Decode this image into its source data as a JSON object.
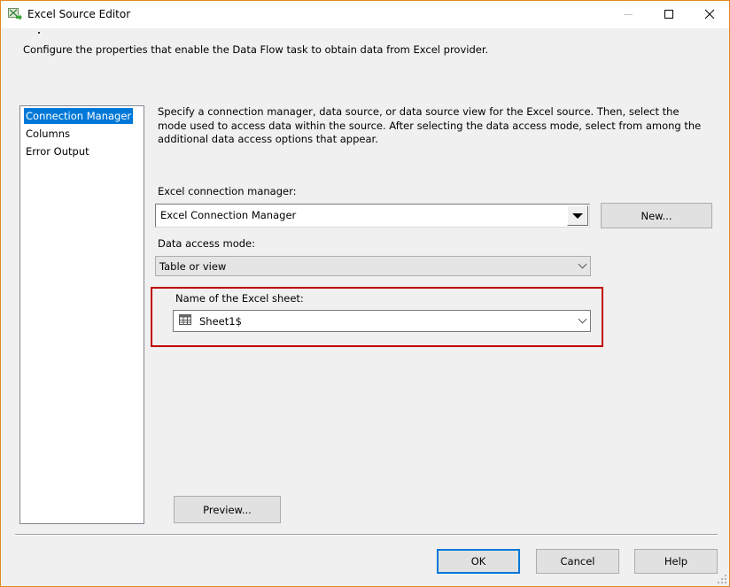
{
  "window": {
    "title": "Excel Source Editor",
    "icon": "excel-source-icon",
    "controls": {
      "minimize": "minimize-icon",
      "maximize": "maximize-icon",
      "close": "close-icon"
    },
    "close_glyph": "✕"
  },
  "header": {
    "description": "Configure the properties that enable the Data Flow task to obtain data from Excel provider."
  },
  "nav": {
    "items": [
      {
        "label": "Connection Manager",
        "selected": true
      },
      {
        "label": "Columns",
        "selected": false
      },
      {
        "label": "Error Output",
        "selected": false
      }
    ]
  },
  "main": {
    "description": "Specify a connection manager, data source, or data source view for the Excel source. Then, select the mode used to access data within the source. After selecting the data access mode, select from among the additional data access options that appear.",
    "connection_manager": {
      "label": "Excel connection manager:",
      "value": "Excel Connection Manager",
      "new_button": "New..."
    },
    "data_access_mode": {
      "label": "Data access mode:",
      "value": "Table or view"
    },
    "sheet": {
      "label": "Name of the Excel sheet:",
      "value": "Sheet1$",
      "icon": "table-icon",
      "highlight_color": "#c00000"
    },
    "preview_button": "Preview..."
  },
  "footer": {
    "ok": "OK",
    "cancel": "Cancel",
    "help": "Help"
  },
  "colors": {
    "accent": "#0078d7",
    "window_border": "#e08a1e",
    "highlight": "#c00000"
  }
}
